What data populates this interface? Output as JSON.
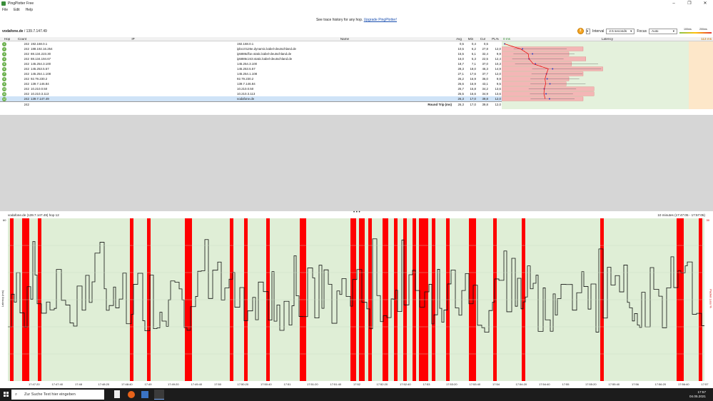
{
  "window": {
    "title": "PingPlotter Free",
    "minimize": "–",
    "maximize": "❐",
    "close": "✕"
  },
  "menu": [
    "File",
    "Edit",
    "Help"
  ],
  "banner": {
    "text": "See trace history for any hop.",
    "link": "Upgrade PingPlotter!"
  },
  "toolbar": {
    "target": "vodafone.de",
    "target_ip": " / 139.7.147.49",
    "interval_label": "Interval",
    "interval_value": "2.5 seconds",
    "focus_label": "Focus",
    "focus_value": "Auto",
    "scale_lo": "100ms",
    "scale_hi": "200ms"
  },
  "columns": {
    "hop": "Hop",
    "count": "Count",
    "ip": "IP",
    "name": "Name",
    "avg": "Avg",
    "min": "Min",
    "cur": "Cur",
    "pl": "PL%",
    "zero": "0 ms",
    "latency": "Latency",
    "max": "113 ms"
  },
  "rows": [
    {
      "hop": "1",
      "count": "242",
      "ip": "192.168.0.1",
      "name": "192.168.0.1",
      "avg": "0,5",
      "min": "0,4",
      "cur": "0,5",
      "pl": "",
      "lat": 0.5,
      "mn": 0.4,
      "mx": 1
    },
    {
      "hop": "2",
      "count": "242",
      "ip": "188.192.16.254",
      "name": "ipbcc0126e.dynamic.kabel-deutschland.de",
      "avg": "10,5",
      "min": "6,2",
      "cur": "27,8",
      "pl": "12,0",
      "lat": 10.5,
      "mn": 6.2,
      "mx": 40
    },
    {
      "hop": "3",
      "count": "242",
      "ip": "88.134.223.30",
      "name": "ip5886df1e.static.kabel-deutschland.de",
      "avg": "15,5",
      "min": "6,1",
      "cur": "32,4",
      "pl": "9,9",
      "lat": 15.5,
      "mn": 6.1,
      "mx": 45
    },
    {
      "hop": "4",
      "count": "242",
      "ip": "88.134.194.67",
      "name": "ip5886c243.static.kabel-deutschland.de",
      "avg": "16,0",
      "min": "5,3",
      "cur": "22,5",
      "pl": "12,4",
      "lat": 16,
      "mn": 5.3,
      "mx": 38
    },
    {
      "hop": "5",
      "count": "242",
      "ip": "145.254.3.100",
      "name": "145.254.3.100",
      "avg": "18,7",
      "min": "7,1",
      "cur": "37,0",
      "pl": "10,3",
      "lat": 18.7,
      "mn": 7.1,
      "mx": 60
    },
    {
      "hop": "6",
      "count": "242",
      "ip": "145.253.5.57",
      "name": "145.253.5.57",
      "avg": "28,3",
      "min": "18,0",
      "cur": "46,3",
      "pl": "14,9",
      "lat": 28.3,
      "mn": 18,
      "mx": 62
    },
    {
      "hop": "7",
      "count": "242",
      "ip": "145.254.1.108",
      "name": "145.254.1.108",
      "avg": "27,1",
      "min": "17,6",
      "cur": "37,7",
      "pl": "12,0",
      "lat": 27.1,
      "mn": 17.6,
      "mx": 50
    },
    {
      "hop": "8",
      "count": "242",
      "ip": "92.79.230.2",
      "name": "92.79.230.2",
      "avg": "26,2",
      "min": "16,9",
      "cur": "36,0",
      "pl": "9,9",
      "lat": 26.2,
      "mn": 16.9,
      "mx": 48
    },
    {
      "hop": "9",
      "count": "242",
      "ip": "139.7.146.84",
      "name": "139.7.146.84",
      "avg": "26,6",
      "min": "16,9",
      "cur": "43,1",
      "pl": "9,5",
      "lat": 26.6,
      "mn": 16.9,
      "mx": 52
    },
    {
      "hop": "10",
      "count": "242",
      "ip": "10.210.0.50",
      "name": "10.210.0.50",
      "avg": "25,7",
      "min": "15,8",
      "cur": "34,2",
      "pl": "13,6",
      "lat": 25.7,
      "mn": 15.8,
      "mx": 46
    },
    {
      "hop": "11",
      "count": "242",
      "ip": "10.210.3.113",
      "name": "10.210.3.113",
      "avg": "25,5",
      "min": "16,6",
      "cur": "34,9",
      "pl": "13,6",
      "lat": 25.5,
      "mn": 16.6,
      "mx": 44
    },
    {
      "hop": "12",
      "count": "242",
      "ip": "139.7.147.49",
      "name": "vodafone.de",
      "avg": "26,3",
      "min": "17,0",
      "cur": "39,8",
      "pl": "12,0",
      "lat": 26.3,
      "mn": 17,
      "mx": 45
    }
  ],
  "summary": {
    "count": "242",
    "label": "Round Trip (ms)",
    "avg": "26,3",
    "min": "17,0",
    "cur": "39,8",
    "pl": "12,0",
    "focus": "Focus: 17:47:05 - 17:57:05"
  },
  "lower": {
    "title": "vodafone.de (139.7.147.49) hop 12",
    "range": "10 minutes (17:47:05 - 17:57:05)",
    "ylabel": "Latency (ms)",
    "y2label": "Packet Loss %",
    "ytop": "60",
    "y2top": "30",
    "ymid_ticks": [
      "50",
      "40",
      "30",
      "20",
      "10",
      "0"
    ]
  },
  "chart_data": {
    "type": "line",
    "ylim": [
      0,
      60
    ],
    "xticks": [
      "17:47:20",
      "17:47:40",
      "17:48",
      "17:48:20",
      "17:48:40",
      "17:49",
      "17:49:20",
      "17:49:40",
      "17:50",
      "17:50:20",
      "17:50:40",
      "17:51",
      "17:51:20",
      "17:51:40",
      "17:52",
      "17:52:20",
      "17:52:40",
      "17:53",
      "17:53:20",
      "17:53:40",
      "17:54",
      "17:54:20",
      "17:54:40",
      "17:55",
      "17:55:20",
      "17:55:40",
      "17:56",
      "17:56:20",
      "17:56:40",
      "17:57"
    ]
  },
  "taskbar": {
    "search": "Zur Suche Text hier eingeben",
    "time": "17:57",
    "date": "04.05.2021"
  },
  "colors": {
    "loss": "#ff0000",
    "graph_bg": "#dfeed6",
    "ok": "#6ab04c"
  }
}
